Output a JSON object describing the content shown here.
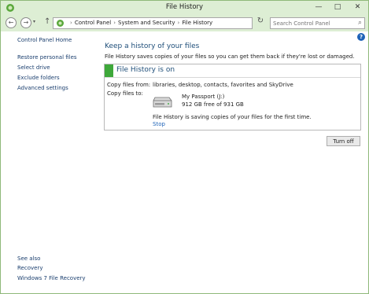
{
  "window": {
    "title": "File History",
    "controls": {
      "minimize": "—",
      "maximize": "□",
      "close": "✕"
    }
  },
  "navigation": {
    "back_icon": "←",
    "forward_icon": "→",
    "recent_icon": "▾",
    "up_icon": "↑",
    "breadcrumb": [
      "Control Panel",
      "System and Security",
      "File History"
    ],
    "separator": "›",
    "dropdown_icon": "▾",
    "refresh_icon": "↻",
    "search": {
      "placeholder": "Search Control Panel",
      "value": ""
    },
    "search_icon": "⌕"
  },
  "help_icon": "?",
  "sidebar": {
    "home": "Control Panel Home",
    "links": [
      "Restore personal files",
      "Select drive",
      "Exclude folders",
      "Advanced settings"
    ],
    "see_also_label": "See also",
    "see_also_links": [
      "Recovery",
      "Windows 7 File Recovery"
    ]
  },
  "main": {
    "heading": "Keep a history of your files",
    "description": "File History saves copies of your files so you can get them back if they're lost or damaged.",
    "status": {
      "title": "File History is on",
      "status_color": "#3ea83a",
      "copy_from_label": "Copy files from:",
      "copy_from_value": "libraries, desktop, contacts, favorites and SkyDrive",
      "copy_to_label": "Copy files to:",
      "drive_name": "My Passport (J:)",
      "drive_space": "912 GB free of 931 GB",
      "progress_text": "File History is saving copies of your files for the first time.",
      "stop_link": "Stop"
    },
    "turn_off_button": "Turn off"
  },
  "colors": {
    "chrome": "#ddeed4",
    "link": "#1a3e6e",
    "heading": "#1e4e79",
    "accent": "#1e63b8"
  }
}
